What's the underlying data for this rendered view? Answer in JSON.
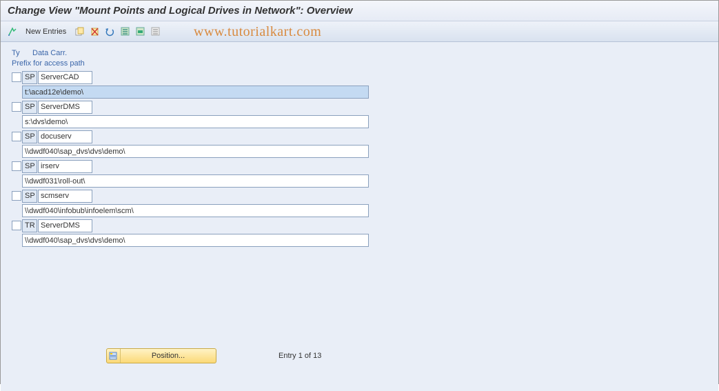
{
  "title": "Change View \"Mount Points and Logical Drives in Network\": Overview",
  "toolbar": {
    "newEntries": "New Entries"
  },
  "watermark": "www.tutorialkart.com",
  "headers": {
    "ty": "Ty",
    "carrier": "Data Carr.",
    "prefix": "Prefix for access path"
  },
  "rows": [
    {
      "ty": "SP",
      "carrier": "ServerCAD",
      "path": "t:\\acad12e\\demo\\",
      "selected": true
    },
    {
      "ty": "SP",
      "carrier": "ServerDMS",
      "path": "s:\\dvs\\demo\\",
      "selected": false
    },
    {
      "ty": "SP",
      "carrier": "docuserv",
      "path": "\\\\dwdf040\\sap_dvs\\dvs\\demo\\",
      "selected": false
    },
    {
      "ty": "SP",
      "carrier": "irserv",
      "path": "\\\\dwdf031\\roll-out\\",
      "selected": false
    },
    {
      "ty": "SP",
      "carrier": "scmserv",
      "path": "\\\\dwdf040\\infobub\\infoelem\\scm\\",
      "selected": false
    },
    {
      "ty": "TR",
      "carrier": "ServerDMS",
      "path": "\\\\dwdf040\\sap_dvs\\dvs\\demo\\",
      "selected": false
    }
  ],
  "footer": {
    "position": "Position...",
    "entryCount": "Entry 1 of 13"
  }
}
